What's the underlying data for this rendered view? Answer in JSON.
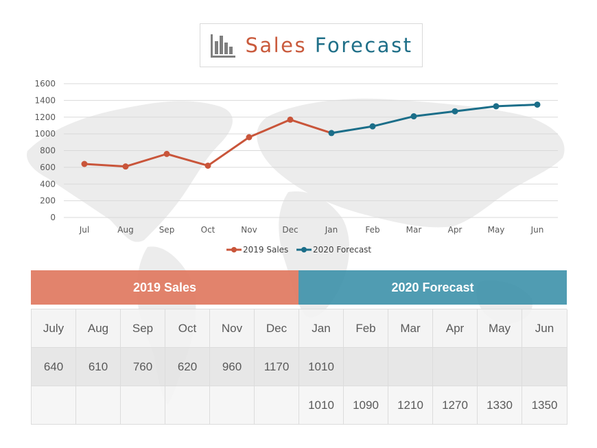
{
  "header": {
    "icon": "bar-chart-icon",
    "title_part1": "Sales",
    "title_part2": "Forecast"
  },
  "colors": {
    "sales": "#c9553a",
    "forecast": "#1b6e89",
    "sales_header": "#e07860",
    "forecast_header": "#3d91aa"
  },
  "chart_data": {
    "type": "line",
    "title": "Sales Forecast",
    "xlabel": "",
    "ylabel": "",
    "categories": [
      "Jul",
      "Aug",
      "Sep",
      "Oct",
      "Nov",
      "Dec",
      "Jan",
      "Feb",
      "Mar",
      "Apr",
      "May",
      "Jun"
    ],
    "ylim": [
      0,
      1600
    ],
    "yticks": [
      0,
      200,
      400,
      600,
      800,
      1000,
      1200,
      1400,
      1600
    ],
    "grid": true,
    "legend_position": "bottom",
    "series": [
      {
        "name": "2019 Sales",
        "color": "#c9553a",
        "values": [
          640,
          610,
          760,
          620,
          960,
          1170,
          1010,
          null,
          null,
          null,
          null,
          null
        ]
      },
      {
        "name": "2020 Forecast",
        "color": "#1b6e89",
        "values": [
          null,
          null,
          null,
          null,
          null,
          null,
          1010,
          1090,
          1210,
          1270,
          1330,
          1350
        ]
      }
    ]
  },
  "table": {
    "group_headers": [
      "2019 Sales",
      "2020 Forecast"
    ],
    "months": [
      "July",
      "Aug",
      "Sep",
      "Oct",
      "Nov",
      "Dec",
      "Jan",
      "Feb",
      "Mar",
      "Apr",
      "May",
      "Jun"
    ],
    "sales_row": [
      "640",
      "610",
      "760",
      "620",
      "960",
      "1170",
      "1010",
      "",
      "",
      "",
      "",
      ""
    ],
    "forecast_row": [
      "",
      "",
      "",
      "",
      "",
      "",
      "1010",
      "1090",
      "1210",
      "1270",
      "1330",
      "1350"
    ]
  }
}
